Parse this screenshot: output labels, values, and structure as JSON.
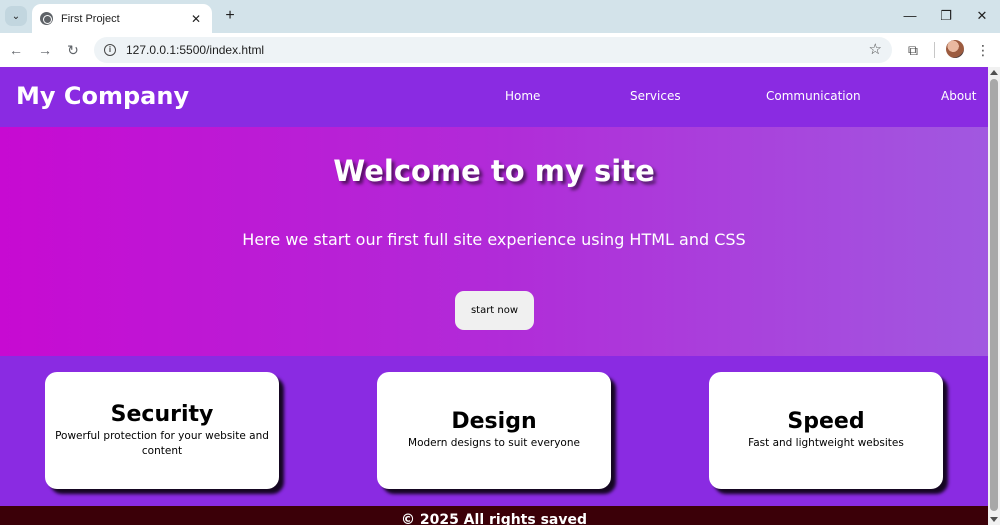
{
  "browser": {
    "tab_title": "First Project",
    "tab_close": "✕",
    "new_tab": "+",
    "url": "127.0.0.1:5500/index.html",
    "window_controls": {
      "minimize": "—",
      "restore": "❐",
      "close": "✕"
    },
    "icons": [
      "tab-search-icon",
      "globe-icon",
      "back-arrow-icon",
      "forward-arrow-icon",
      "reload-icon",
      "info-icon",
      "star-icon",
      "extensions-icon",
      "profile-avatar",
      "kebab-menu-icon"
    ]
  },
  "site": {
    "brand": "My Company",
    "nav": [
      "Home",
      "Services",
      "Communication",
      "About"
    ],
    "hero": {
      "title": "Welcome to my site",
      "subtitle": "Here we start our first full site experience using HTML and CSS",
      "cta": "start now"
    },
    "cards": [
      {
        "title": "Security",
        "text": "Powerful protection for your website and content"
      },
      {
        "title": "Design",
        "text": "Modern designs to suit everyone"
      },
      {
        "title": "Speed",
        "text": "Fast and lightweight websites"
      }
    ],
    "footer": "© 2025 All rights saved",
    "colors": {
      "header": "#8a2be2",
      "hero_start": "#c70ad2",
      "hero_end": "#a158e0",
      "card": "#ffffff",
      "footer": "#3b0008"
    }
  }
}
